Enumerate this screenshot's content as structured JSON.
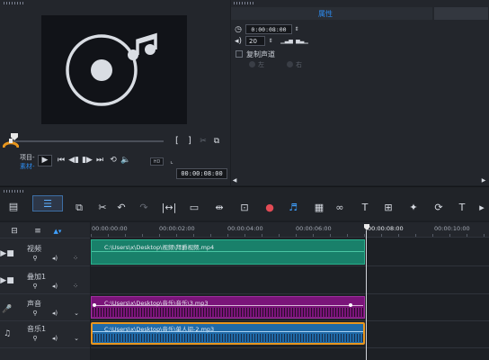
{
  "options": {
    "title": "属性",
    "timecode": "0:00:08:00",
    "volume": "20",
    "duplicate_channel_label": "复制声道",
    "left_label": "左",
    "right_label": "右"
  },
  "preview": {
    "project_label": "项目-",
    "clip_label": "素材-",
    "quality_label": "HD",
    "timecode": "00:00:08:00"
  },
  "timeline": {
    "ruler_labels": [
      "00:00:00:00",
      "00:00:02:00",
      "00:00:04:00",
      "00:00:06:00",
      "00:00:08:00",
      "00:00:10:00"
    ],
    "tracks": [
      {
        "name": "视频",
        "clip": "C:\\Users\\x\\Desktop\\视频\\拜爵视频.mp4"
      },
      {
        "name": "叠加1",
        "clip": ""
      },
      {
        "name": "声音",
        "clip": "C:\\Users\\x\\Desktop\\音乐\\音乐\\3.mp3"
      },
      {
        "name": "音乐1",
        "clip": "C:\\Users\\x\\Desktop\\音乐\\单人间-2.mp3"
      }
    ]
  },
  "colors": {
    "video_clip": "#19806a",
    "voice_clip": "#7a1479",
    "music_clip": "#1f6aa8",
    "selection": "#e8961e",
    "accent": "#2d8cf0"
  },
  "icons": [
    "music-disc-icon",
    "play-icon",
    "undo-icon",
    "redo-icon",
    "mixer-icon",
    "volume-icon"
  ]
}
